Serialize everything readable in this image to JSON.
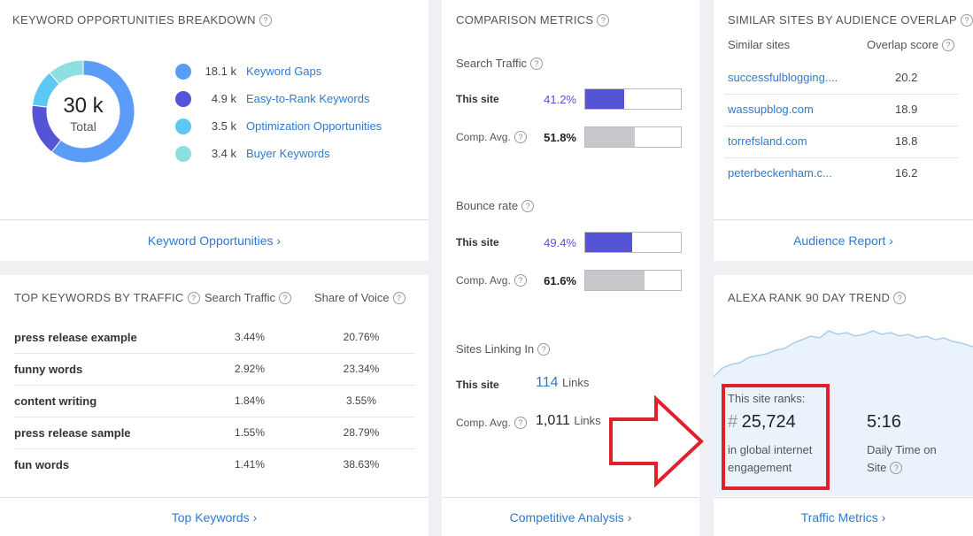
{
  "keyword_opportunities": {
    "title": "KEYWORD OPPORTUNITIES BREAKDOWN",
    "help": "?",
    "donut_total": "30 k",
    "donut_label": "Total",
    "items": [
      {
        "value": "18.1 k",
        "label": "Keyword Gaps",
        "color": "#5a9cf8",
        "amount": 18.1
      },
      {
        "value": "4.9 k",
        "label": "Easy-to-Rank Keywords",
        "color": "#5553d6",
        "amount": 4.9
      },
      {
        "value": "3.5 k",
        "label": "Optimization Opportunities",
        "color": "#5bc8f5",
        "amount": 3.5
      },
      {
        "value": "3.4 k",
        "label": "Buyer Keywords",
        "color": "#8ee0e0",
        "amount": 3.4
      }
    ],
    "footer": "Keyword Opportunities ›"
  },
  "top_keywords": {
    "title": "TOP KEYWORDS BY TRAFFIC",
    "col_traffic": "Search Traffic",
    "col_voice": "Share of Voice",
    "help": "?",
    "rows": [
      {
        "keyword": "press release example",
        "traffic": "3.44%",
        "voice": "20.76%"
      },
      {
        "keyword": "funny words",
        "traffic": "2.92%",
        "voice": "23.34%"
      },
      {
        "keyword": "content writing",
        "traffic": "1.84%",
        "voice": "3.55%"
      },
      {
        "keyword": "press release sample",
        "traffic": "1.55%",
        "voice": "28.79%"
      },
      {
        "keyword": "fun words",
        "traffic": "1.41%",
        "voice": "38.63%"
      }
    ],
    "footer": "Top Keywords ›"
  },
  "comparison": {
    "title": "COMPARISON METRICS",
    "help": "?",
    "search_traffic": {
      "label": "Search Traffic",
      "this_label": "This site",
      "this_value": "41.2%",
      "this_pct": 41.2,
      "avg_label": "Comp. Avg.",
      "avg_value": "51.8%",
      "avg_pct": 51.8
    },
    "bounce_rate": {
      "label": "Bounce rate",
      "this_label": "This site",
      "this_value": "49.4%",
      "this_pct": 49.4,
      "avg_label": "Comp. Avg.",
      "avg_value": "61.6%",
      "avg_pct": 61.6
    },
    "sites_linking": {
      "label": "Sites Linking In",
      "this_label": "This site",
      "this_value": "114",
      "this_unit": "Links",
      "avg_label": "Comp. Avg.",
      "avg_value": "1,011",
      "avg_unit": "Links"
    },
    "colors": {
      "this_fill": "#5553d6",
      "avg_fill": "#c8c8cc",
      "this_text": "#5553d6"
    },
    "footer": "Competitive Analysis ›"
  },
  "similar_sites": {
    "title": "SIMILAR SITES BY AUDIENCE OVERLAP",
    "col_sites": "Similar sites",
    "col_score": "Overlap score",
    "help": "?",
    "rows": [
      {
        "site": "successfulblogging....",
        "score": "20.2"
      },
      {
        "site": "wassupblog.com",
        "score": "18.9"
      },
      {
        "site": "torrefsland.com",
        "score": "18.8"
      },
      {
        "site": "peterbeckenham.c...",
        "score": "16.2"
      }
    ],
    "footer": "Audience Report ›"
  },
  "alexa": {
    "title": "ALEXA RANK 90 DAY TREND",
    "help": "?",
    "ranks_label": "This site ranks:",
    "hash": "#",
    "rank": "25,724",
    "rank_desc": "in global internet engagement",
    "time": "5:16",
    "time_desc": "Daily Time on Site",
    "footer": "Traffic Metrics ›",
    "highlight_color": "#e0202a"
  }
}
